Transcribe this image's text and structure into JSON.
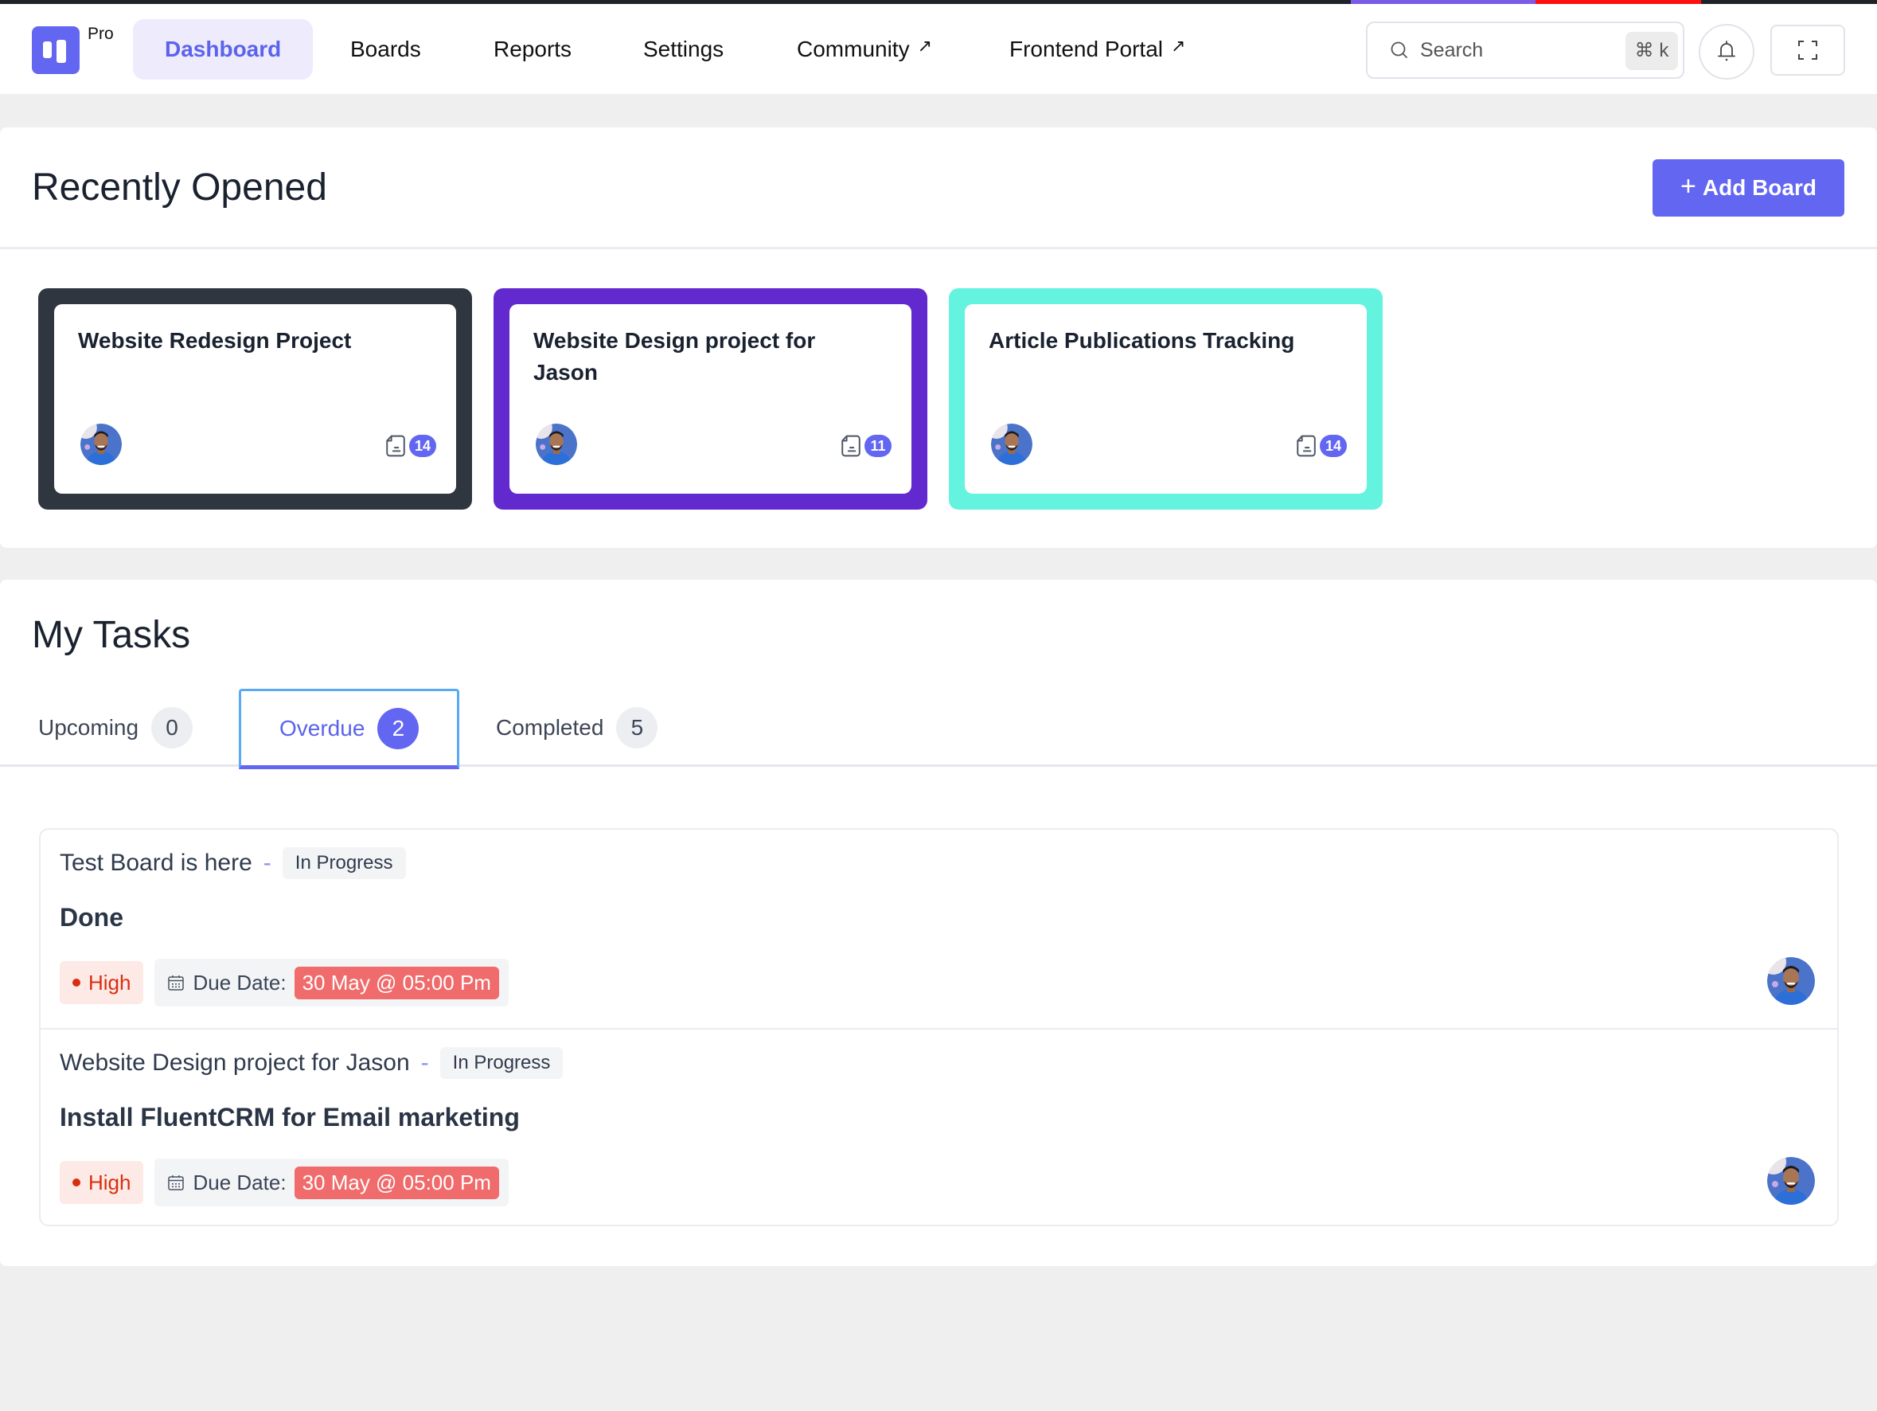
{
  "topbar": {
    "logo_label": "Pro",
    "nav": [
      {
        "label": "Dashboard",
        "active": true,
        "external": false
      },
      {
        "label": "Boards",
        "active": false,
        "external": false
      },
      {
        "label": "Reports",
        "active": false,
        "external": false
      },
      {
        "label": "Settings",
        "active": false,
        "external": false
      },
      {
        "label": "Community",
        "active": false,
        "external": true
      },
      {
        "label": "Frontend Portal",
        "active": false,
        "external": true
      }
    ],
    "external_icon": "↗",
    "search": {
      "placeholder": "Search",
      "shortcut": "⌘ k"
    },
    "icons": [
      "search-icon",
      "bell-icon",
      "fullscreen-icon"
    ]
  },
  "recent": {
    "title": "Recently Opened",
    "add_board_label": "Add Board",
    "boards": [
      {
        "title": "Website Redesign Project",
        "color": "#2f3640",
        "task_count": "14"
      },
      {
        "title": "Website Design project for Jason",
        "color": "#6229cf",
        "task_count": "11"
      },
      {
        "title": "Article Publications Tracking",
        "color": "#64f3de",
        "task_count": "14"
      }
    ]
  },
  "tasks": {
    "title": "My Tasks",
    "tabs": [
      {
        "label": "Upcoming",
        "count": "0",
        "active": false
      },
      {
        "label": "Overdue",
        "count": "2",
        "active": true
      },
      {
        "label": "Completed",
        "count": "5",
        "active": false
      }
    ],
    "items": [
      {
        "board": "Test Board is here",
        "separator": "-",
        "stage": "In Progress",
        "title": "Done",
        "priority": "High",
        "due_label": "Due Date:",
        "due_date": "30 May @ 05:00 Pm"
      },
      {
        "board": "Website Design project for Jason",
        "separator": "-",
        "stage": "In Progress",
        "title": "Install FluentCRM for Email marketing",
        "priority": "High",
        "due_label": "Due Date:",
        "due_date": "30 May @ 05:00 Pm"
      }
    ]
  },
  "colors": {
    "accent": "#6366f1",
    "priority_high": "#d92d0f",
    "overdue_date": "#f06b6b"
  }
}
